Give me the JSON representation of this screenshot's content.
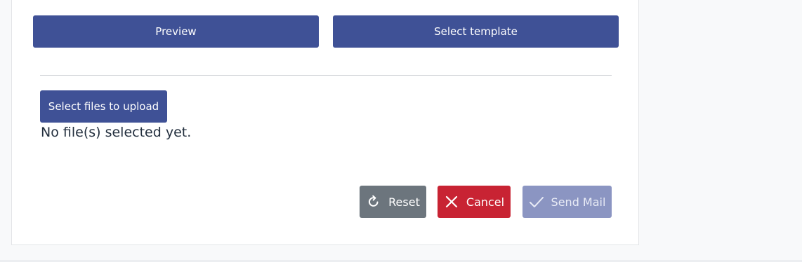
{
  "top_buttons": {
    "preview_label": "Preview",
    "template_label": "Select template"
  },
  "upload": {
    "button_label": "Select files to upload",
    "status_text": "No file(s) selected yet."
  },
  "actions": {
    "reset_label": "Reset",
    "cancel_label": "Cancel",
    "send_label": "Send Mail",
    "reset_icon": "reset-icon",
    "cancel_icon": "close-icon",
    "send_icon": "check-icon"
  },
  "colors": {
    "primary": "#3f5196",
    "secondary": "#6c757d",
    "danger": "#c82333",
    "disabled_primary": "#8b95c2"
  }
}
